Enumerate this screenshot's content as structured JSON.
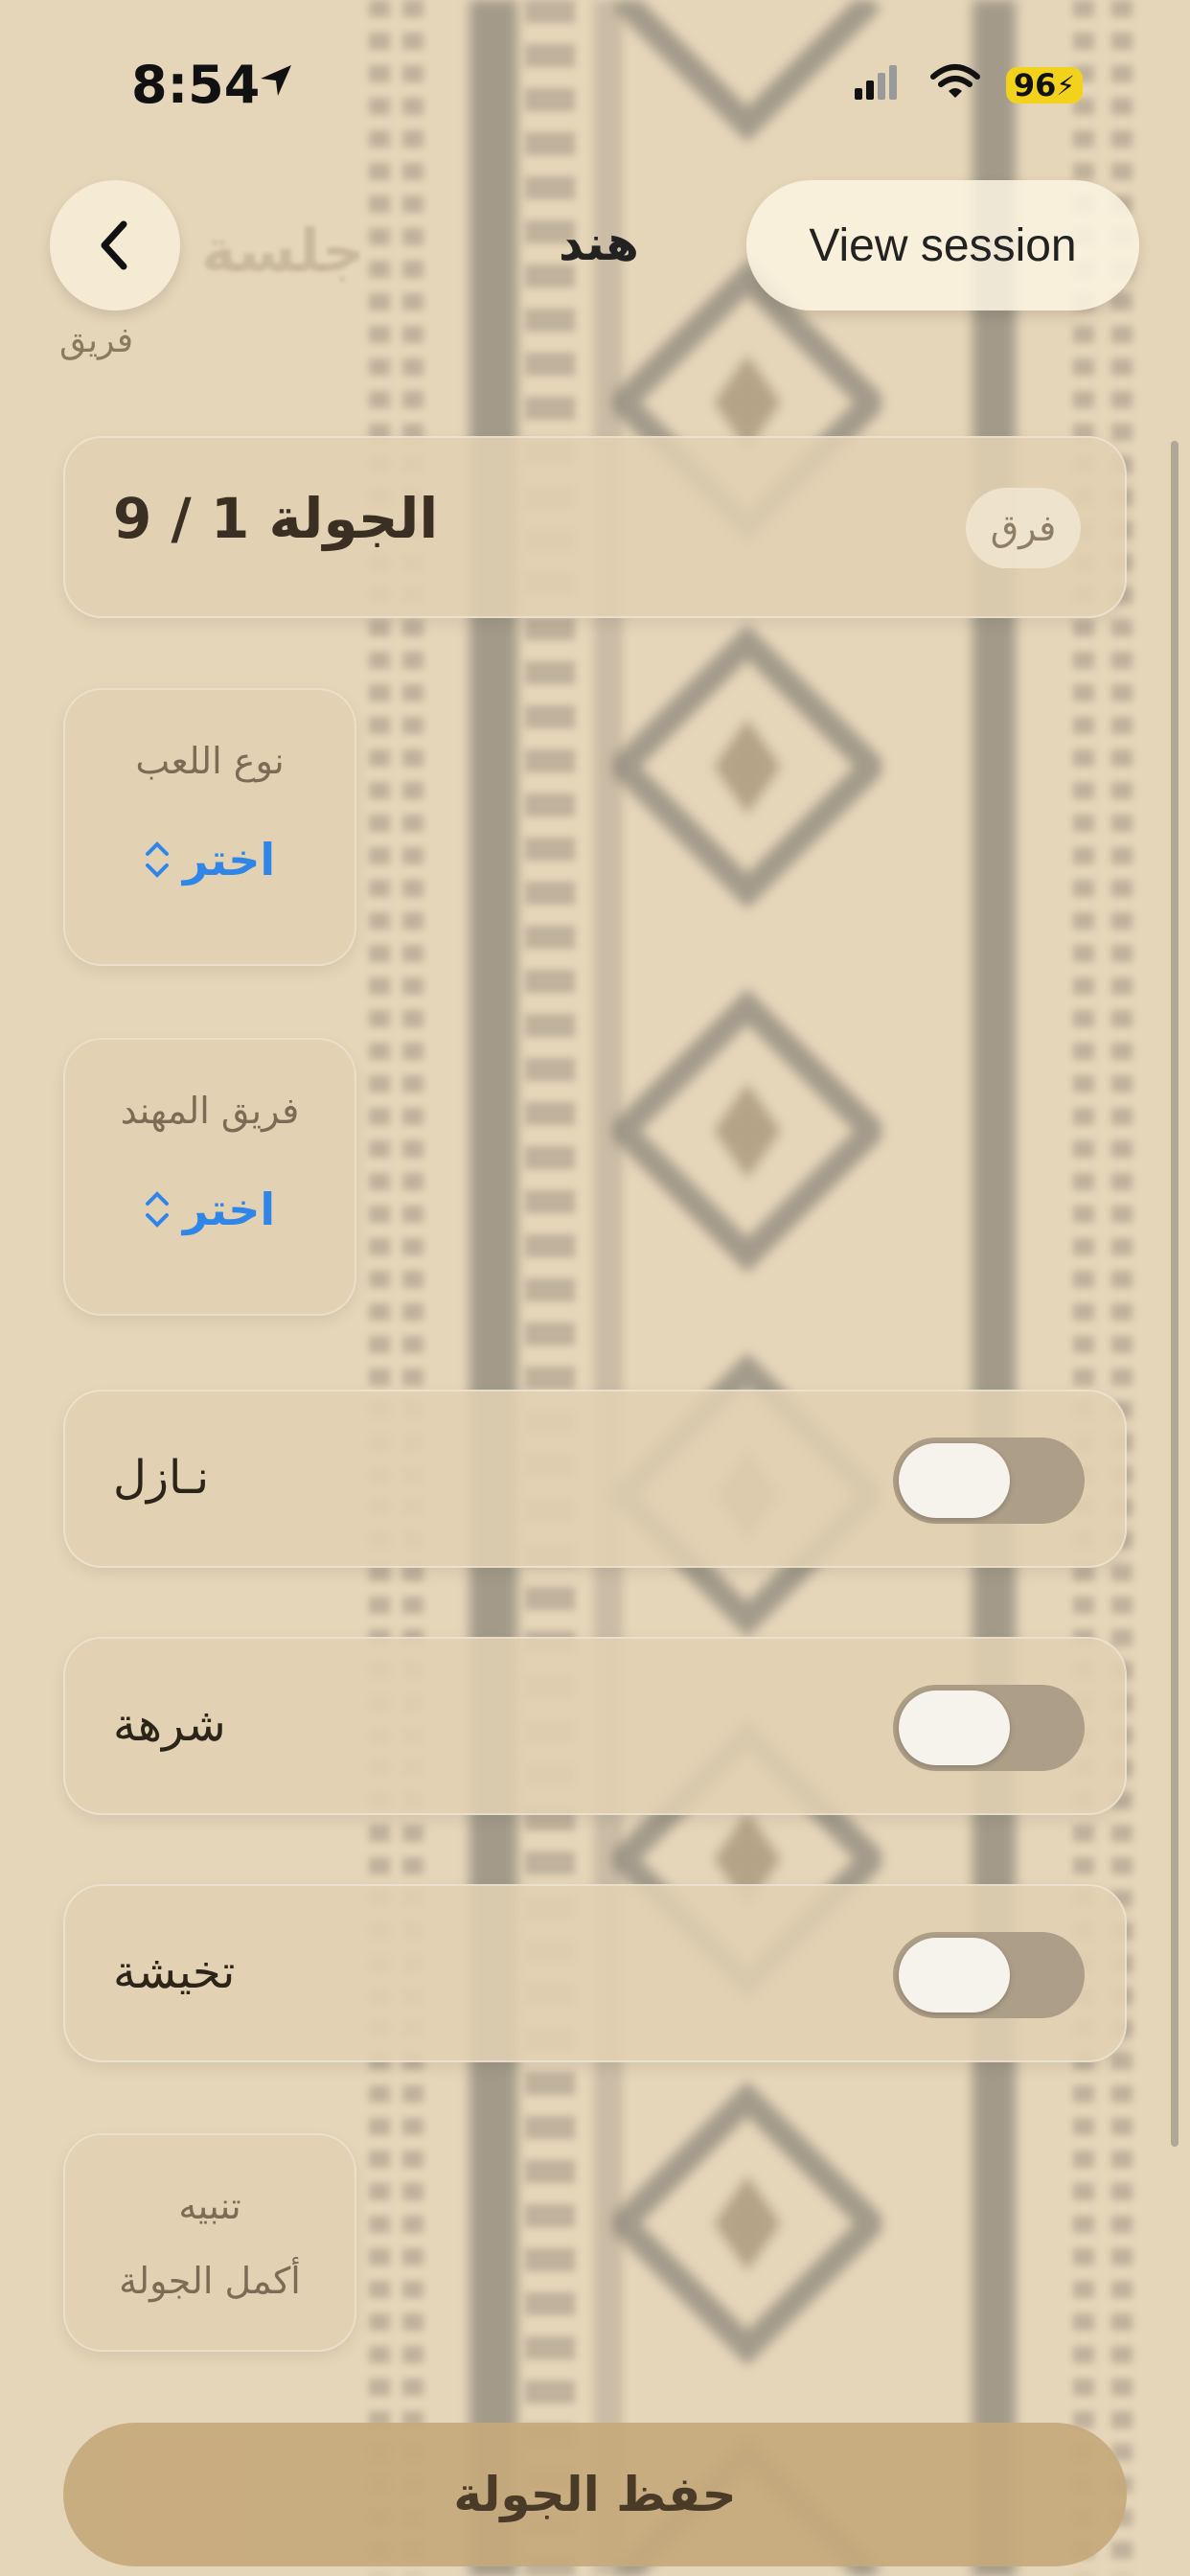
{
  "status_bar": {
    "time": "8:54",
    "battery": "96"
  },
  "nav": {
    "ghost_title": "جلسة",
    "title": "هند",
    "subtitle": "فريق",
    "view_session_label": "View session"
  },
  "round": {
    "text": "الجولة 1 / 9",
    "badge": "فرق"
  },
  "game_type": {
    "label": "نوع اللعب",
    "value": "اختر"
  },
  "engineer_team": {
    "label": "فريق المهند",
    "value": "اختر"
  },
  "toggles": [
    {
      "label": "نـازل",
      "on": false
    },
    {
      "label": "شرهة",
      "on": false
    },
    {
      "label": "تخيشة",
      "on": false
    }
  ],
  "notice": {
    "title": "تنبيه",
    "text": "أكمل الجولة"
  },
  "save_label": "حفظ الجولة"
}
